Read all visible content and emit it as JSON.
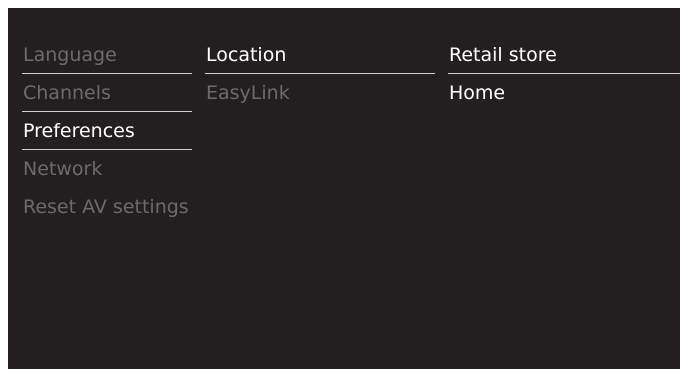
{
  "menu": {
    "level1": [
      {
        "label": "Language",
        "state": "inactive"
      },
      {
        "label": "Channels",
        "state": "inactive"
      },
      {
        "label": "Preferences",
        "state": "selected"
      },
      {
        "label": "Network",
        "state": "inactive"
      },
      {
        "label": "Reset AV settings",
        "state": "inactive"
      }
    ],
    "level2": [
      {
        "label": "Location",
        "state": "selected"
      },
      {
        "label": "EasyLink",
        "state": "inactive"
      }
    ],
    "level3": [
      {
        "label": "Retail store",
        "state": "highlighted"
      },
      {
        "label": "Home",
        "state": "option"
      }
    ]
  },
  "colors": {
    "background": "#231f20",
    "active_text": "#ffffff",
    "inactive_text": "#6d6a6a",
    "divider": "#cfcfcf"
  }
}
